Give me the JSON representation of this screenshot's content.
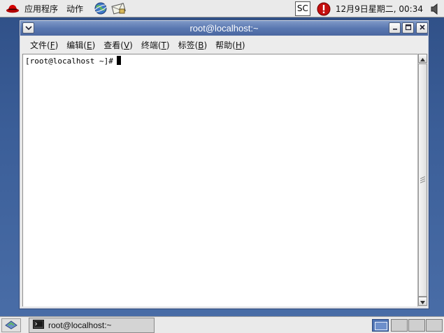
{
  "top_panel": {
    "applications_menu": "应用程序",
    "actions_menu": "动作",
    "input_indicator": "SC",
    "clock": "12月9日星期二, 00:34"
  },
  "window": {
    "title": "root@localhost:~",
    "menu": [
      {
        "label": "文件(",
        "accel": "F",
        "close": ")"
      },
      {
        "label": "编辑(",
        "accel": "E",
        "close": ")"
      },
      {
        "label": "查看(",
        "accel": "V",
        "close": ")"
      },
      {
        "label": "终端(",
        "accel": "T",
        "close": ")"
      },
      {
        "label": "标签(",
        "accel": "B",
        "close": ")"
      },
      {
        "label": "帮助(",
        "accel": "H",
        "close": ")"
      }
    ],
    "prompt": "[root@localhost ~]#"
  },
  "bottom_panel": {
    "task_label": "root@localhost:~"
  },
  "colors": {
    "desktop": "#3b5e98",
    "titlebar": "#5a78b1",
    "alert": "#d01010",
    "redhat": "#cc0000"
  }
}
